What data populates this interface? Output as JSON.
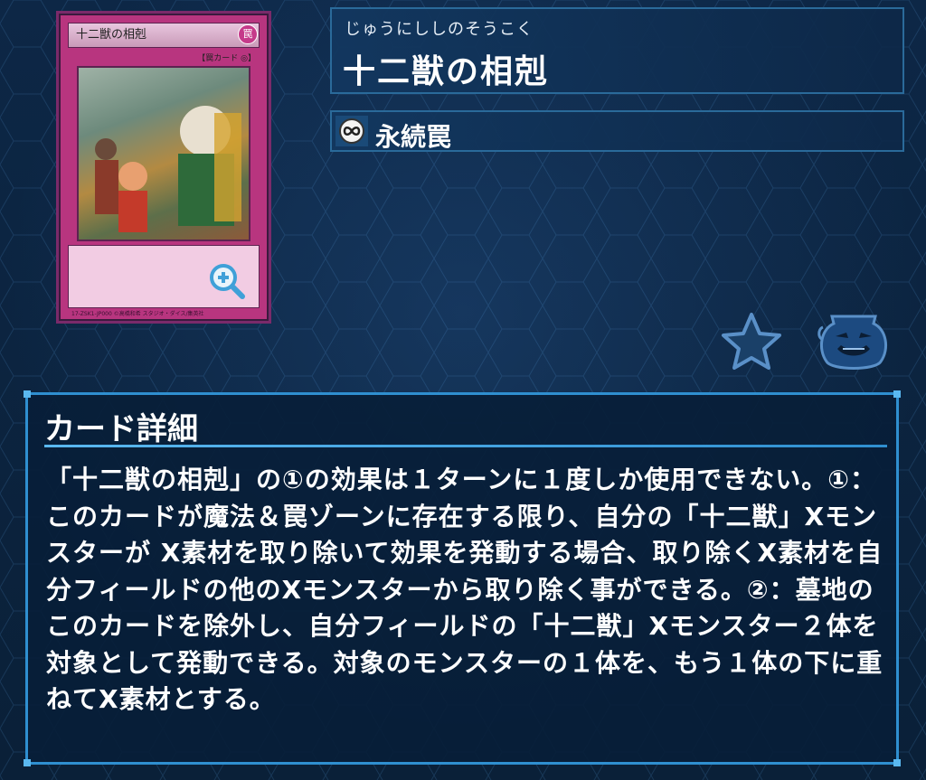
{
  "card": {
    "art_name": "十二獣の相剋",
    "art_type_line": "【罠カード ◎】",
    "ruby": "じゅうにししのそうこく",
    "name": "十二獣の相剋",
    "type_icon": "infinity-icon",
    "type_label": "永続罠"
  },
  "detail": {
    "heading": "カード詳細",
    "text": "「十二獣の相剋」の①の効果は１ターンに１度しか使用できない。①：このカードが魔法＆罠ゾーンに存在する限り、自分の「十二獣」Xモンスターが X素材を取り除いて効果を発動する場合、取り除くX素材を自分フィールドの他のXモンスターから取り除く事ができる。②：墓地のこのカードを除外し、自分フィールドの「十二獣」Xモンスター２体を対象として発動できる。対象のモンスターの１体を、もう１体の下に重ねてX素材とする。"
  },
  "icons": {
    "zoom": "zoom-in-icon",
    "favorite": "star-icon",
    "pot": "pot-icon"
  }
}
